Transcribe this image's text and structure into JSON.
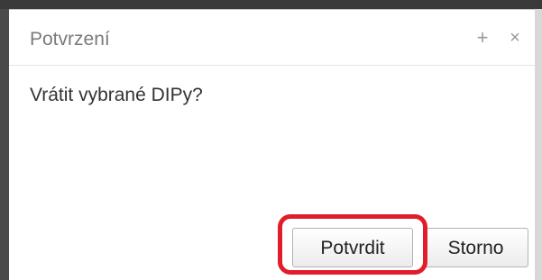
{
  "dialog": {
    "title": "Potvrzení",
    "maximize_icon": "+",
    "close_icon": "×",
    "message": "Vrátit vybrané DIPy?",
    "buttons": {
      "confirm_label": "Potvrdit",
      "cancel_label": "Storno"
    },
    "highlight_color": "#e01d2a"
  }
}
